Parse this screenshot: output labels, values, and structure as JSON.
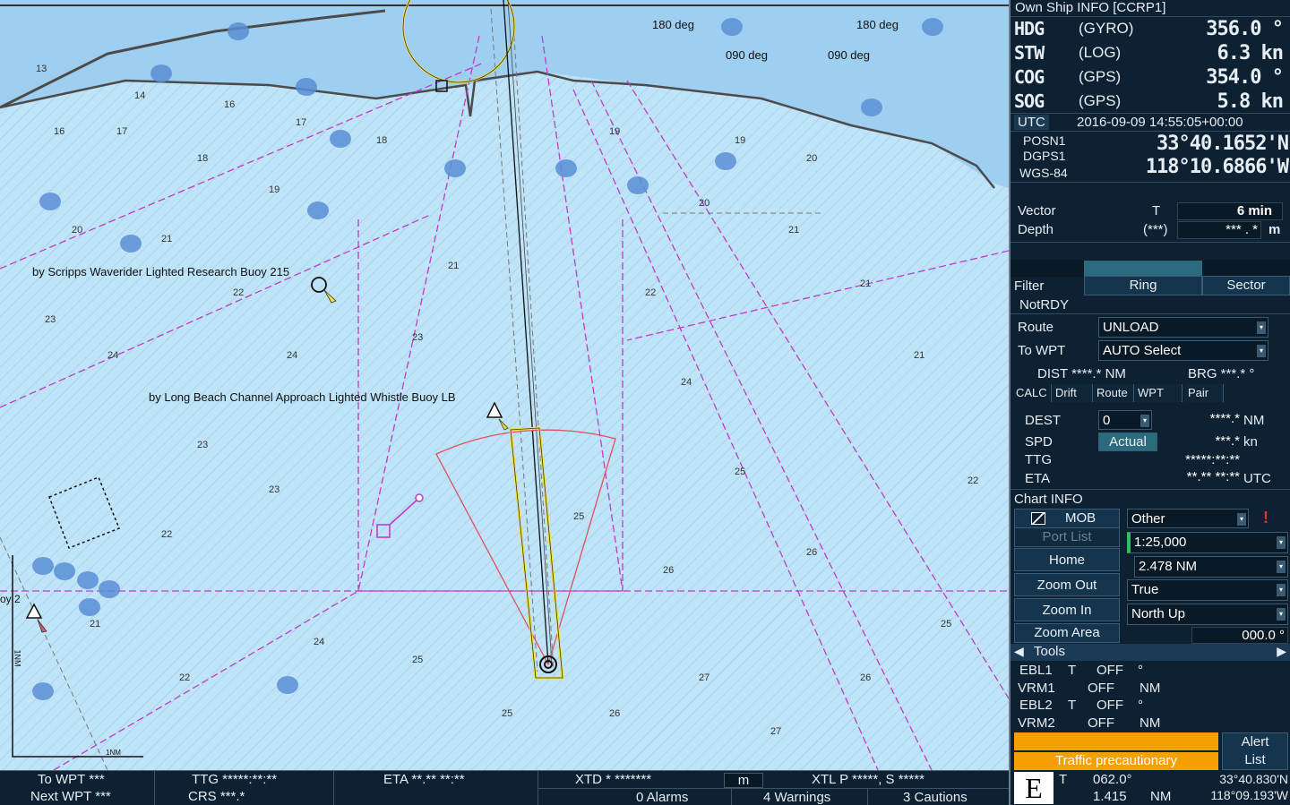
{
  "chart": {
    "annotations": {
      "scripps_buoy": "by Scripps Waverider Lighted Research Buoy 215",
      "long_beach_buoy": "by Long Beach Channel Approach Lighted Whistle Buoy LB"
    },
    "bearing_labels": [
      "180 deg",
      "090 deg",
      "180 deg",
      "090 deg"
    ],
    "side_label": "oy 2",
    "scale_label": "1NM",
    "scale_vert_label": "1NM"
  },
  "own_ship": {
    "title": "Own Ship INFO [CCRP1]",
    "hdg_label": "HDG",
    "hdg_src": "(GYRO)",
    "hdg_value": "356.0 °",
    "stw_label": "STW",
    "stw_src": "(LOG)",
    "stw_value": "6.3 kn",
    "cog_label": "COG",
    "cog_src": "(GPS)",
    "cog_value": "354.0 °",
    "sog_label": "SOG",
    "sog_src": "(GPS)",
    "sog_value": "5.8 kn",
    "utc_label": "UTC",
    "utc_value": "2016-09-09 14:55:05+00:00",
    "posn_label": "POSN1",
    "dgps_label": "DGPS1",
    "datum_label": "WGS-84",
    "lat": "33°40.1652'N",
    "lon": "118°10.6866'W",
    "vector_label": "Vector",
    "vector_mode": "T",
    "vector_value": "6 min",
    "depth_label": "Depth",
    "depth_src": "(***)",
    "depth_value": "*** . *",
    "depth_unit": "m"
  },
  "filter": {
    "label": "Filter",
    "ring": "Ring",
    "sector": "Sector",
    "status": "NotRDY"
  },
  "route": {
    "route_label": "Route",
    "route_value": "UNLOAD",
    "wpt_label": "To WPT",
    "wpt_value": "AUTO Select",
    "dist": "DIST ****.* NM",
    "brg": "BRG ***.* °"
  },
  "calc": {
    "tabs": [
      "CALC",
      "Drift",
      "Route",
      "WPT",
      "Pair"
    ],
    "dest_label": "DEST",
    "dest_value": "0",
    "dest_nm": "****.*",
    "dest_unit": "NM",
    "spd_label": "SPD",
    "spd_mode": "Actual",
    "spd_value": "***.*",
    "spd_unit": "kn",
    "ttg_label": "TTG",
    "ttg_value": "*****:**:**",
    "eta_label": "ETA",
    "eta_value": "**.** **:**",
    "eta_unit": "UTC"
  },
  "chart_info": {
    "title": "Chart INFO",
    "mob": "MOB",
    "other": "Other",
    "port_list": "Port List",
    "scale": "1:25,000",
    "home": "Home",
    "range": "2.478 NM",
    "zoom_out": "Zoom Out",
    "motion": "True",
    "zoom_in": "Zoom In",
    "orientation": "North Up",
    "zoom_area": "Zoom Area",
    "rotation": "000.0 °"
  },
  "tools": {
    "title": "Tools",
    "ebl1_label": "EBL1",
    "ebl1_mode": "T",
    "ebl1_value": "OFF",
    "ebl1_unit": "°",
    "vrm1_label": "VRM1",
    "vrm1_value": "OFF",
    "vrm1_unit": "NM",
    "ebl2_label": "EBL2",
    "ebl2_mode": "T",
    "ebl2_value": "OFF",
    "ebl2_unit": "°",
    "vrm2_label": "VRM2",
    "vrm2_value": "OFF",
    "vrm2_unit": "NM"
  },
  "alert": {
    "message": "Traffic precautionary",
    "list_line1": "Alert",
    "list_line2": "List",
    "mode_letter": "E",
    "cursor_mode": "T",
    "cursor_brg": "062.0°",
    "cursor_rng": "1.415",
    "cursor_unit": "NM",
    "cursor_lat": "33°40.830'N",
    "cursor_lon": "118°09.193'W"
  },
  "bottom": {
    "to_wpt": "To WPT ***",
    "next_wpt": "Next WPT ***",
    "ttg": "TTG *****:**:**",
    "crs": "CRS ***.*",
    "eta": "ETA **.** **:**",
    "xtd": "XTD * *******",
    "xtd_unit": "m",
    "xtl": "XTL P *****, S *****",
    "alarms": "0 Alarms",
    "warnings": "4 Warnings",
    "cautions": "3 Cautions"
  },
  "colors": {
    "alert_orange": "#f5a000",
    "route_yellow": "#f0e040",
    "chart_magenta": "#c03cc8",
    "sea_light": "#bfe3f7",
    "sea_mid": "#9fcff0",
    "land": "#e6d9a8"
  }
}
